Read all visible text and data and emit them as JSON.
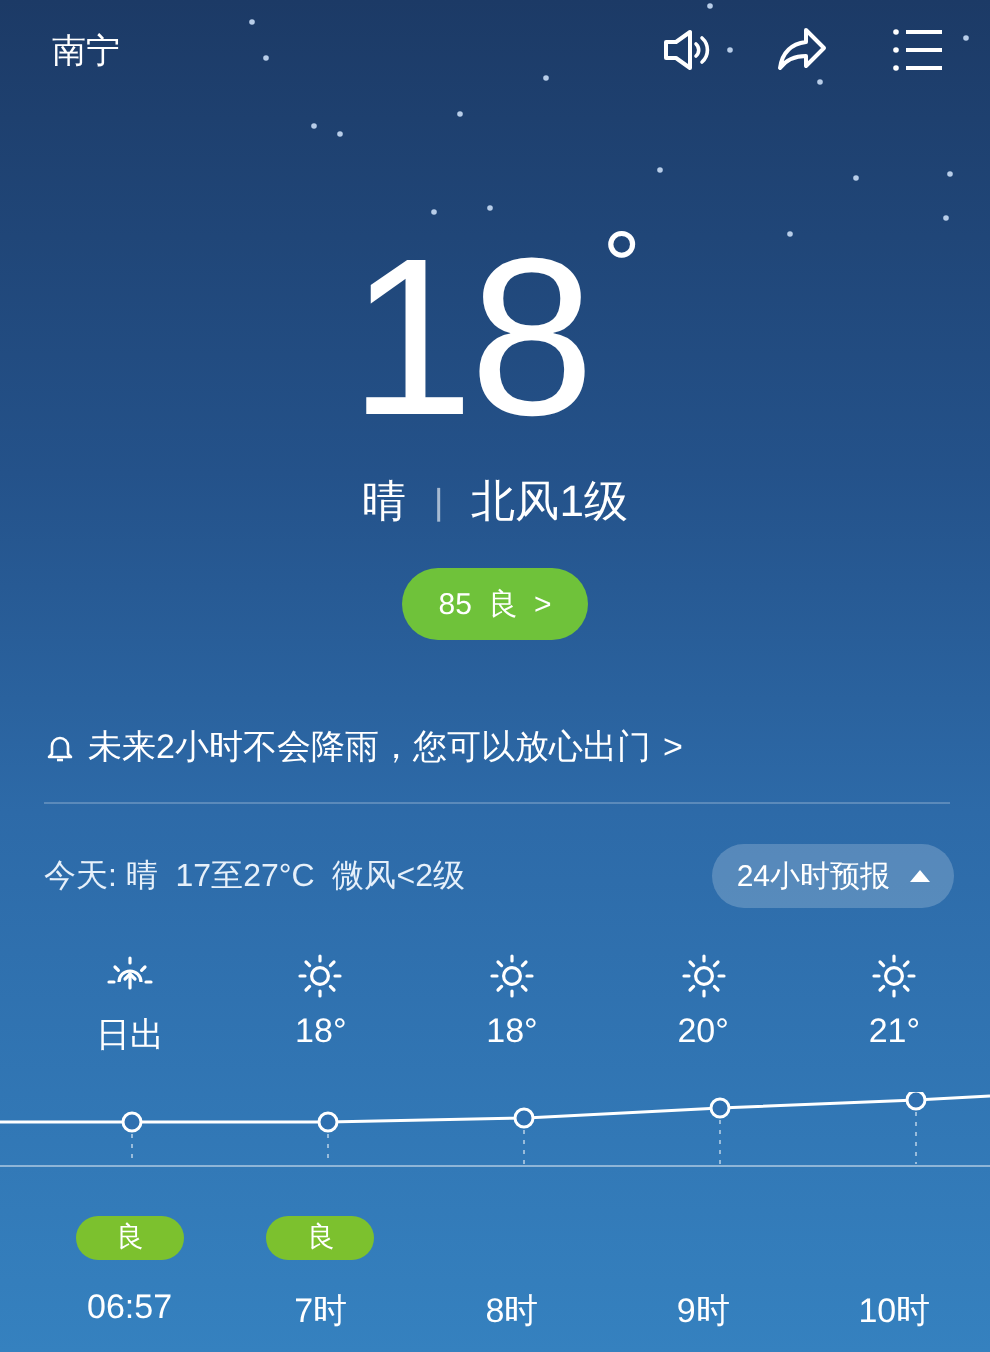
{
  "city": "南宁",
  "temperature": "18",
  "unit": "°",
  "condition": "晴",
  "separator": "|",
  "wind": "北风1级",
  "aqi": {
    "value": "85",
    "level": "良",
    "chevron": ">"
  },
  "alert": {
    "text": "未来2小时不会降雨，您可以放心出门",
    "chevron": ">"
  },
  "today": "今天: 晴  17至27°C  微风<2级",
  "forecast_toggle": {
    "label": "24小时预报",
    "expanded": true
  },
  "hours": [
    {
      "kind": "sunrise",
      "label": "日出",
      "time": "06:57",
      "air": "良"
    },
    {
      "kind": "sunny",
      "label": "18°",
      "time": "7时",
      "air": "良"
    },
    {
      "kind": "sunny",
      "label": "18°",
      "time": "8时"
    },
    {
      "kind": "sunny",
      "label": "20°",
      "time": "9时"
    },
    {
      "kind": "sunny",
      "label": "21°",
      "time": "10时"
    }
  ]
}
